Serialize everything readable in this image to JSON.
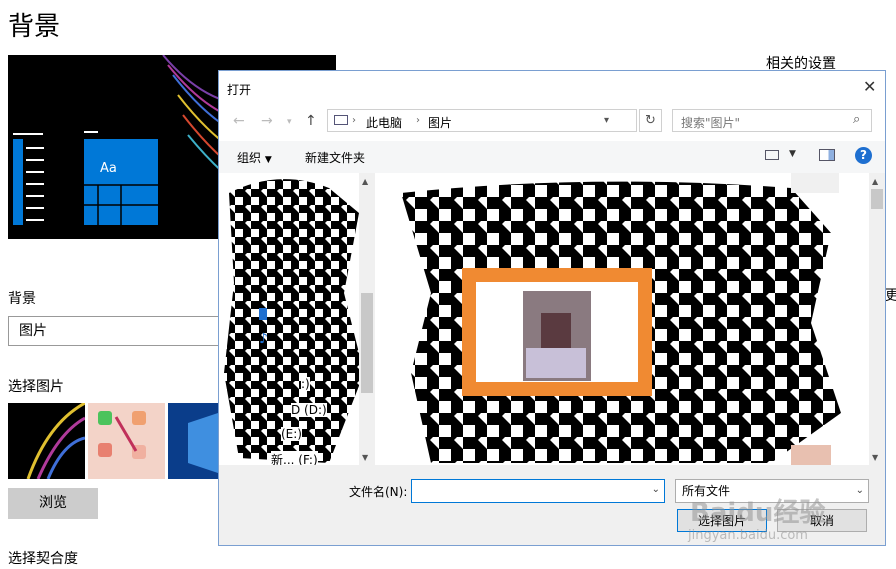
{
  "settings": {
    "title": "背景",
    "related_settings": "相关的设置",
    "background_label": "背景",
    "background_value": "图片",
    "choose_picture_label": "选择图片",
    "browse_label": "浏览",
    "choose_fit_label": "选择契合度",
    "edge_char": "更",
    "preview_tile_text": "Aa"
  },
  "dialog": {
    "title": "打开",
    "address": [
      "此电脑",
      "图片"
    ],
    "search_placeholder": "搜索\"图片\"",
    "toolbar": {
      "organize": "组织",
      "new_folder": "新建文件夹"
    },
    "nav_items": [
      ":)",
      "D (D:)",
      "(E:)",
      "新... (F:)"
    ],
    "filename_label": "文件名(N):",
    "filename_value": "",
    "filetype_value": "所有文件",
    "open_button": "选择图片",
    "cancel_button": "取消"
  },
  "watermark": {
    "brand": "Baidu经验",
    "url": "jingyan.baidu.com"
  },
  "colors": {
    "accent": "#0078d7",
    "highlight": "#f08a32"
  }
}
